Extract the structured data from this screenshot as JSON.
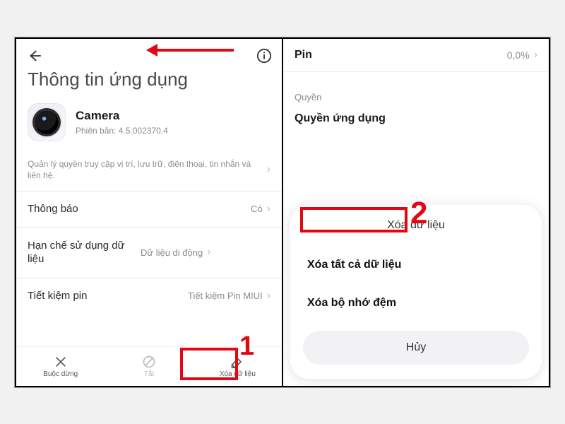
{
  "left": {
    "page_title": "Thông tin ứng dụng",
    "app": {
      "name": "Camera",
      "version_label": "Phiên bản: 4.5.002370.4"
    },
    "permissions_desc": "Quản lý quyền truy cập vị trí, lưu trữ, điện thoại, tin nhắn và liên hệ.",
    "rows": {
      "notifications": {
        "label": "Thông báo",
        "value": "Có"
      },
      "restrict": {
        "label": "Hạn chế sử dụng dữ liệu",
        "value": "Dữ liệu di động"
      },
      "battery": {
        "label": "Tiết kiệm pin",
        "value": "Tiết kiệm Pin MIUI"
      }
    },
    "actions": {
      "force_stop": "Buộc dừng",
      "disable": "Tắt",
      "clear_data": "Xóa dữ liệu"
    }
  },
  "right": {
    "battery": {
      "label": "Pin",
      "value": "0,0%"
    },
    "section_perm": "Quyền",
    "app_perm": "Quyền ứng dụng",
    "sheet": {
      "title": "Xóa dữ liệu",
      "clear_all": "Xóa tất cả dữ liệu",
      "clear_cache": "Xóa bộ nhớ đệm",
      "cancel": "Hủy"
    }
  },
  "annotations": {
    "step1": "1",
    "step2": "2"
  }
}
